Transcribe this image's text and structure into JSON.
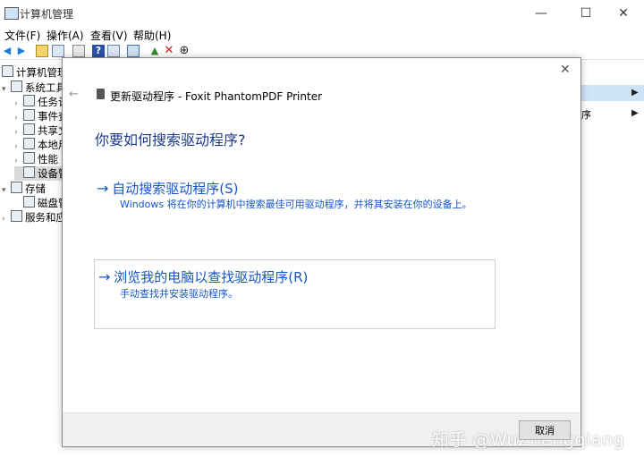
{
  "window": {
    "title": "计算机管理",
    "minimize": "—",
    "maximize": "☐",
    "close": "✕"
  },
  "menu": [
    "文件(F)",
    "操作(A)",
    "查看(V)",
    "帮助(H)"
  ],
  "tree": {
    "root": "计算机管理",
    "system_tools": "系统工具",
    "items": [
      "任务计",
      "事件查",
      "共享文",
      "本地用",
      "性能",
      "设备管"
    ],
    "storage": "存储",
    "disk": "磁盘管",
    "services": "服务和应"
  },
  "right_pane": {
    "text": "序"
  },
  "dialog": {
    "title": "更新驱动程序 - Foxit PhantomPDF Printer",
    "heading": "你要如何搜索驱动程序?",
    "option1": {
      "label": "自动搜索驱动程序(S)",
      "desc": "Windows 将在你的计算机中搜索最佳可用驱动程序，并将其安装在你的设备上。"
    },
    "option2": {
      "label": "浏览我的电脑以查找驱动程序(R)",
      "desc": "手动查找并安装驱动程序。"
    },
    "cancel": "取消"
  },
  "watermark": "知乎 @WuZhengqiang"
}
